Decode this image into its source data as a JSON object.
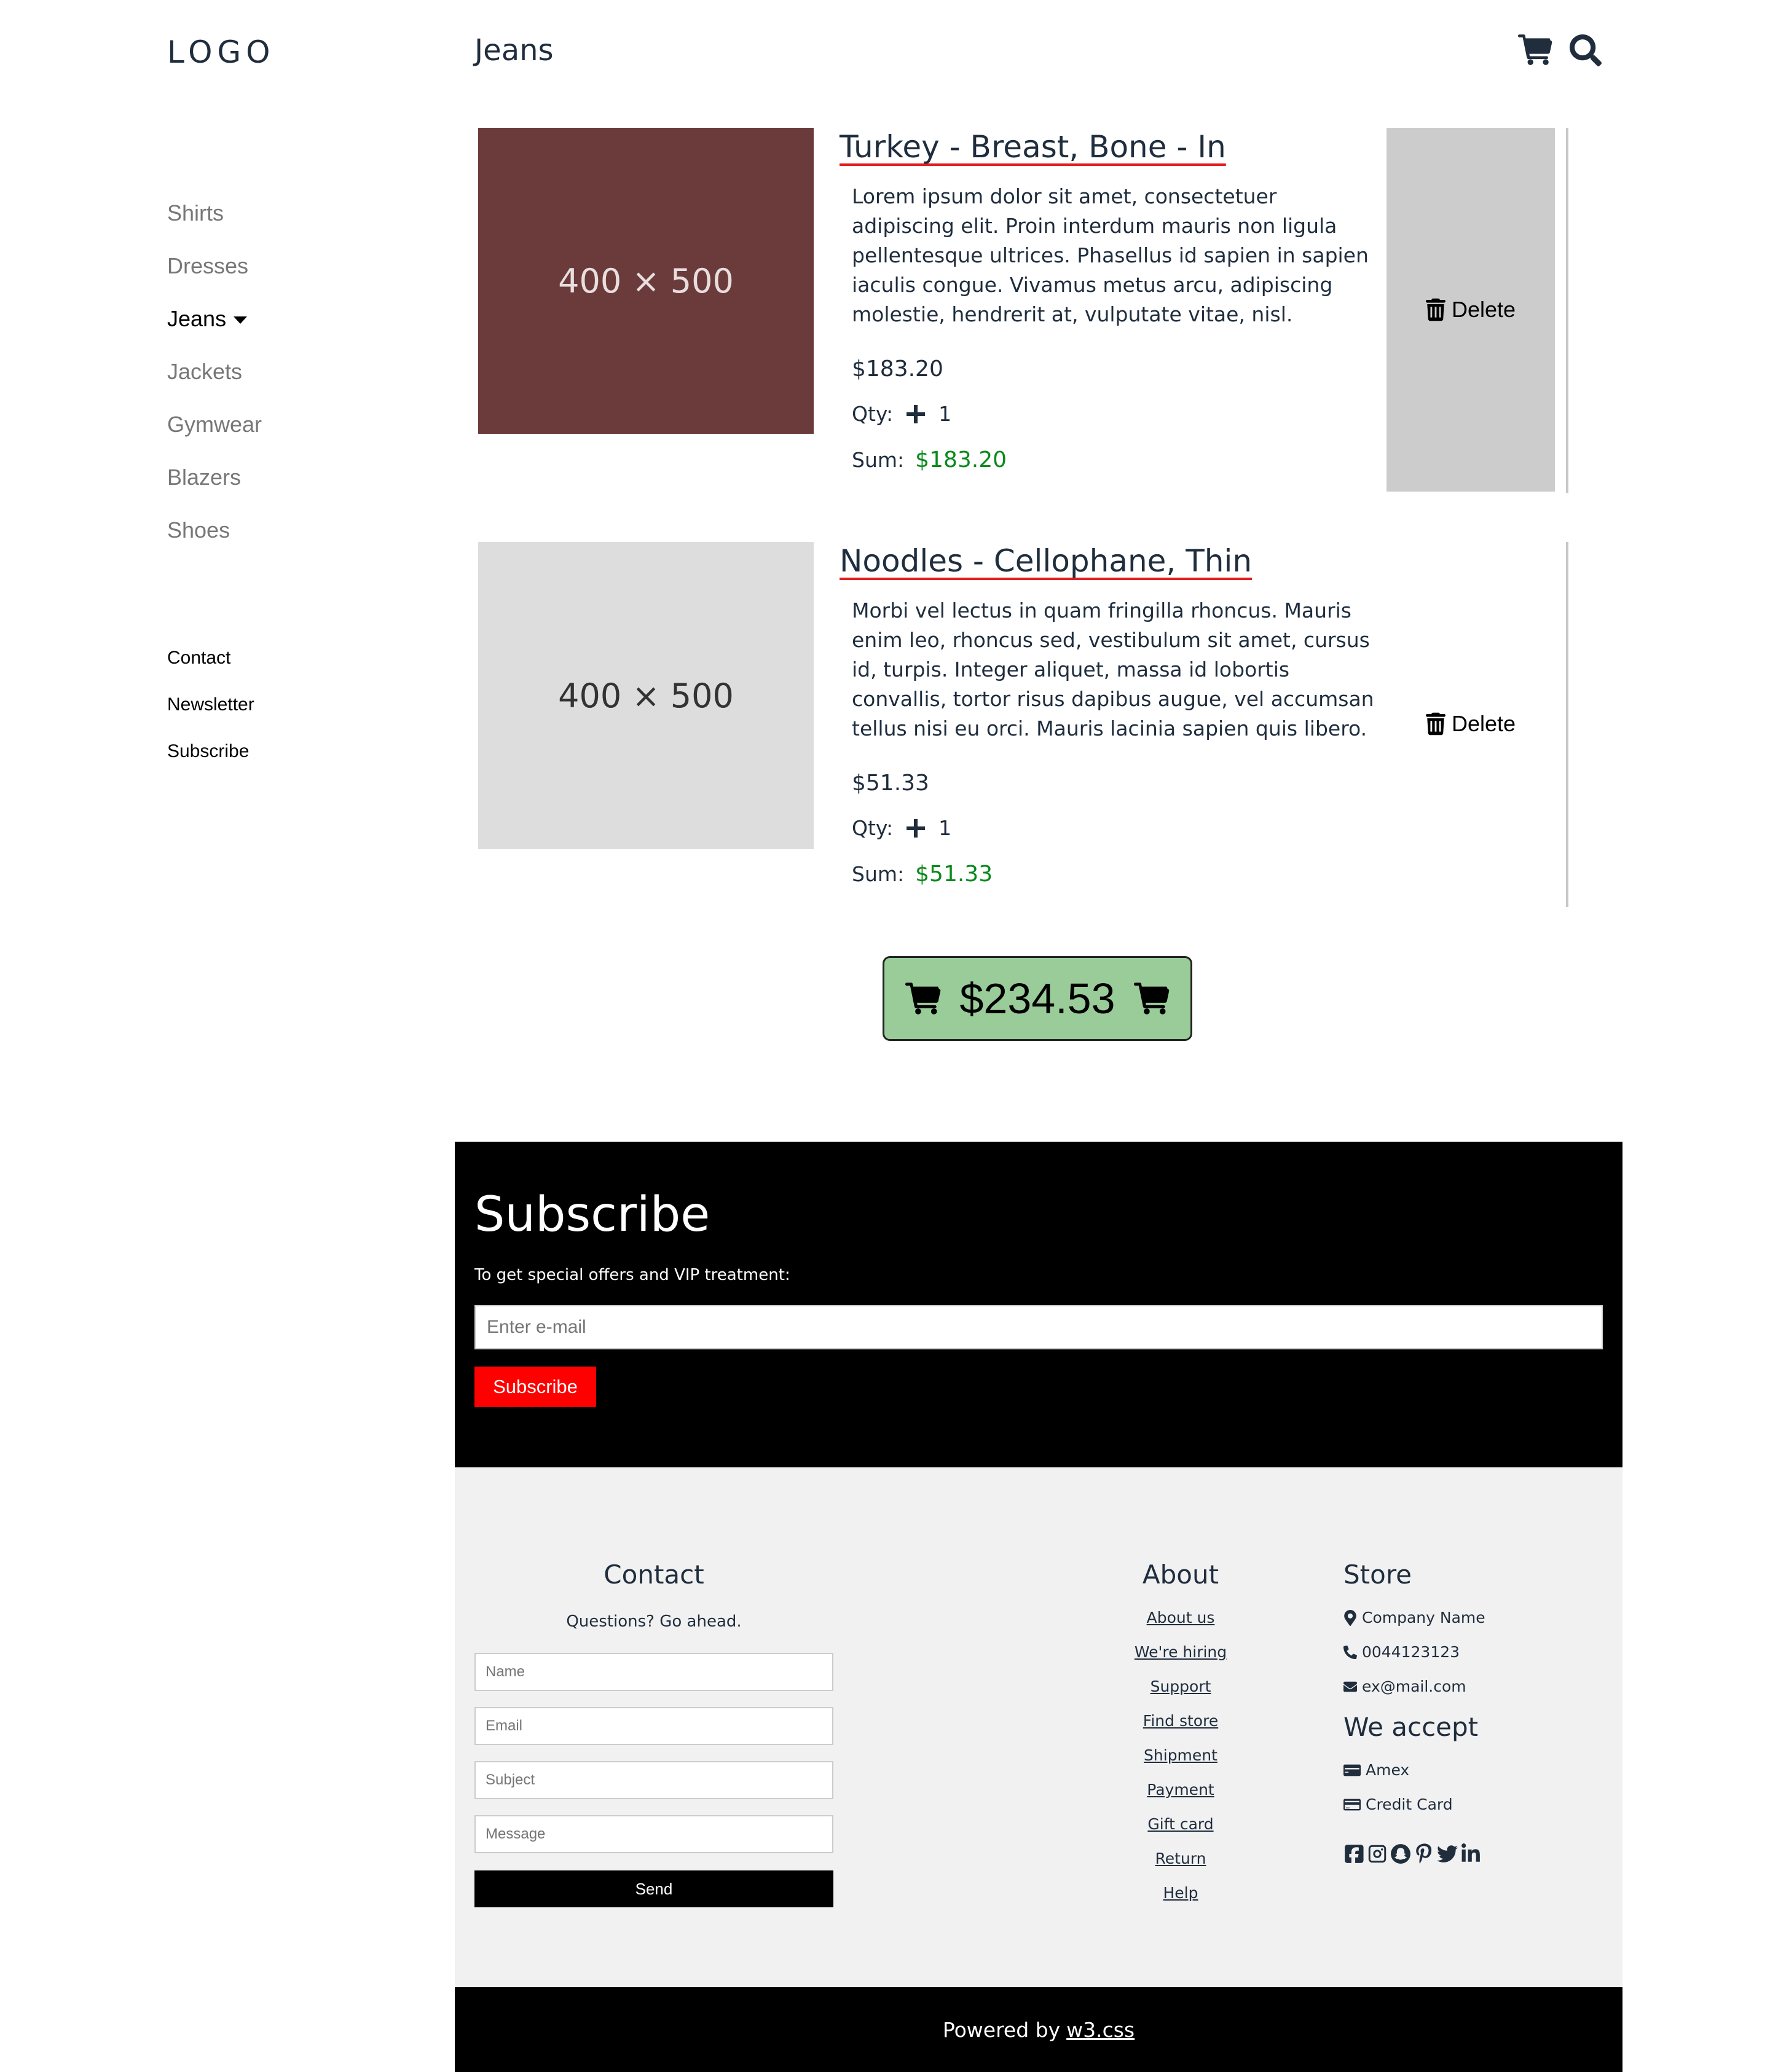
{
  "brand": {
    "logo": "LOGO"
  },
  "header": {
    "title": "Jeans"
  },
  "sidebar": {
    "categories": [
      {
        "label": "Shirts"
      },
      {
        "label": "Dresses"
      },
      {
        "label": "Jeans"
      },
      {
        "label": "Jackets"
      },
      {
        "label": "Gymwear"
      },
      {
        "label": "Blazers"
      },
      {
        "label": "Shoes"
      }
    ],
    "links": [
      {
        "label": "Contact"
      },
      {
        "label": "Newsletter"
      },
      {
        "label": "Subscribe"
      }
    ]
  },
  "cart": {
    "items": [
      {
        "title": "Turkey - Breast, Bone - In",
        "image_placeholder": "400 × 500",
        "image_bg": "#6b3b3b",
        "image_text_color": "#e8dede",
        "description": "Lorem ipsum dolor sit amet, consectetuer adipiscing elit. Proin interdum mauris non ligula pellentesque ultrices. Phasellus id sapien in sapien iaculis congue. Vivamus metus arcu, adipiscing molestie, hendrerit at, vulputate vitae, nisl.",
        "price": "$183.20",
        "qty_label": "Qty:",
        "qty": "1",
        "sum_label": "Sum:",
        "sum": "$183.20",
        "delete_label": "Delete",
        "delete_bg": "#cccccc"
      },
      {
        "title": "Noodles - Cellophane, Thin",
        "image_placeholder": "400 × 500",
        "image_bg": "#dddddd",
        "image_text_color": "#333333",
        "description": "Morbi vel lectus in quam fringilla rhoncus. Mauris enim leo, rhoncus sed, vestibulum sit amet, cursus id, turpis. Integer aliquet, massa id lobortis convallis, tortor risus dapibus augue, vel accumsan tellus nisi eu orci. Mauris lacinia sapien quis libero.",
        "price": "$51.33",
        "qty_label": "Qty:",
        "qty": "1",
        "sum_label": "Sum:",
        "sum": "$51.33",
        "delete_label": "Delete",
        "delete_bg": "#ffffff"
      }
    ],
    "total": "$234.53"
  },
  "subscribe": {
    "title": "Subscribe",
    "text": "To get special offers and VIP treatment:",
    "email_placeholder": "Enter e-mail",
    "button": "Subscribe"
  },
  "footer": {
    "contact": {
      "title": "Contact",
      "subtitle": "Questions? Go ahead.",
      "name_placeholder": "Name",
      "email_placeholder": "Email",
      "subject_placeholder": "Subject",
      "message_placeholder": "Message",
      "send": "Send"
    },
    "about": {
      "title": "About",
      "links": [
        "About us",
        "We're hiring",
        "Support",
        "Find store",
        "Shipment",
        "Payment",
        "Gift card",
        "Return",
        "Help"
      ]
    },
    "store": {
      "title": "Store",
      "company": "Company Name",
      "phone": "0044123123",
      "email": "ex@mail.com",
      "accept_title": "We accept",
      "payments": [
        "Amex",
        "Credit Card"
      ],
      "social_icons": [
        "facebook-icon",
        "instagram-icon",
        "snapchat-icon",
        "pinterest-icon",
        "twitter-icon",
        "linkedin-icon"
      ]
    },
    "powered_prefix": "Powered by",
    "powered_link": "w3.css"
  },
  "colors": {
    "accent_green": "#0a8a1c",
    "total_bg": "#99cc99",
    "subscribe_btn": "#ff0000",
    "title_underline": "#e21f1f"
  }
}
